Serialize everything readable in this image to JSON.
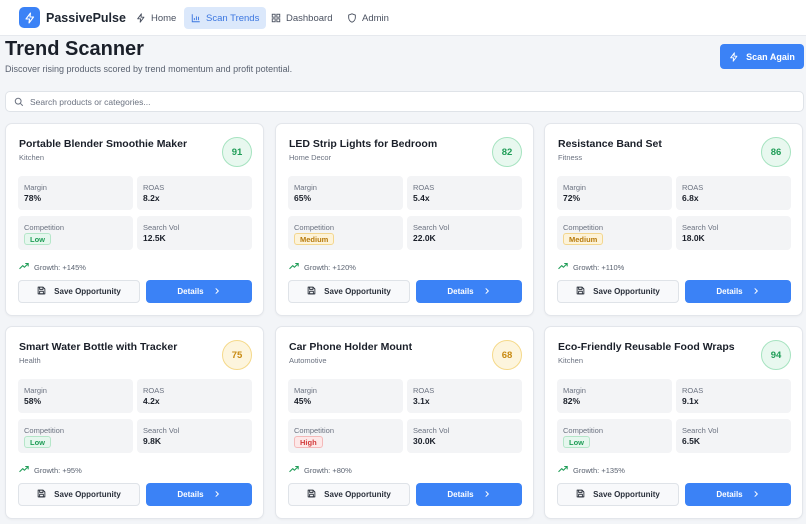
{
  "app": {
    "brand": "PassivePulse"
  },
  "nav": [
    {
      "label": "Home",
      "icon": "bolt-icon",
      "active": false
    },
    {
      "label": "Scan Trends",
      "icon": "chart-icon",
      "active": true
    },
    {
      "label": "Dashboard",
      "icon": "grid-icon",
      "active": false
    },
    {
      "label": "Admin",
      "icon": "shield-icon",
      "active": false
    }
  ],
  "header": {
    "title": "Trend Scanner",
    "subtitle": "Discover rising products scored by trend momentum and profit potential.",
    "scan_label": "Scan Again"
  },
  "search": {
    "placeholder": "Search products or categories..."
  },
  "labels": {
    "margin": "Margin",
    "roas": "ROAS",
    "competition": "Competition",
    "search_vol": "Search Vol",
    "save": "Save Opportunity",
    "details": "Details"
  },
  "colors": {
    "accent": "#3b82f6",
    "score_green": "#1f9d57",
    "score_amber": "#c88a12"
  },
  "products": [
    {
      "name": "Portable Blender Smoothie Maker",
      "category": "Kitchen",
      "score": "91",
      "score_level": "green",
      "margin": "78%",
      "roas": "8.2x",
      "competition": "Low",
      "search_vol": "12.5K",
      "growth": "Growth: +145%"
    },
    {
      "name": "LED Strip Lights for Bedroom",
      "category": "Home Decor",
      "score": "82",
      "score_level": "green",
      "margin": "65%",
      "roas": "5.4x",
      "competition": "Medium",
      "search_vol": "22.0K",
      "growth": "Growth: +120%"
    },
    {
      "name": "Resistance Band Set",
      "category": "Fitness",
      "score": "86",
      "score_level": "green",
      "margin": "72%",
      "roas": "6.8x",
      "competition": "Medium",
      "search_vol": "18.0K",
      "growth": "Growth: +110%"
    },
    {
      "name": "Smart Water Bottle with Tracker",
      "category": "Health",
      "score": "75",
      "score_level": "amber",
      "margin": "58%",
      "roas": "4.2x",
      "competition": "Low",
      "search_vol": "9.8K",
      "growth": "Growth: +95%"
    },
    {
      "name": "Car Phone Holder Mount",
      "category": "Automotive",
      "score": "68",
      "score_level": "amber",
      "margin": "45%",
      "roas": "3.1x",
      "competition": "High",
      "search_vol": "30.0K",
      "growth": "Growth: +80%"
    },
    {
      "name": "Eco-Friendly Reusable Food Wraps",
      "category": "Kitchen",
      "score": "94",
      "score_level": "green",
      "margin": "82%",
      "roas": "9.1x",
      "competition": "Low",
      "search_vol": "6.5K",
      "growth": "Growth: +135%"
    }
  ]
}
